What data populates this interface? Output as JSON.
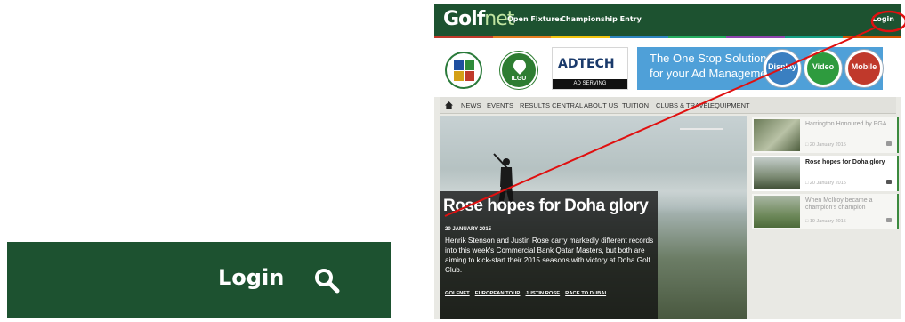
{
  "callout": {
    "login_label": "Login",
    "search_icon": "search-icon",
    "bg_color": "#1d5230"
  },
  "site": {
    "logo_main": "Golf",
    "logo_suffix": "net",
    "topnav": [
      "Open Fixtures",
      "Championship Entry"
    ],
    "login_label": "Login",
    "stripe_colors": [
      "#c0392b",
      "#e67e22",
      "#f1c40f",
      "#2e86c1",
      "#27ae60",
      "#8e44ad",
      "#16a085",
      "#d35400"
    ]
  },
  "banner": {
    "crest2_text": "ILGU",
    "ad_brand": "ADTECH",
    "ad_brand_sub": "AD SERVING",
    "ad_line1": "The One Stop Solution",
    "ad_line2": "for your Ad Management!",
    "pills": [
      {
        "label": "Display",
        "color": "#3a7fc1"
      },
      {
        "label": "Video",
        "color": "#2e9b3e"
      },
      {
        "label": "Mobile",
        "color": "#c0392b"
      }
    ]
  },
  "mainnav": {
    "home_icon": "home-icon",
    "items": [
      "NEWS",
      "EVENTS",
      "RESULTS CENTRAL",
      "ABOUT US",
      "TUITION",
      "CLUBS & TRAVEL",
      "EQUIPMENT"
    ]
  },
  "hero": {
    "headline": "Rose hopes for Doha glory",
    "date": "20 JANUARY 2015",
    "body": "Henrik Stenson and Justin Rose carry markedly different records into this week's Commercial Bank Qatar Masters, but both are aiming to kick-start their 2015 seasons with victory at Doha Golf Club.",
    "tags": [
      "GOLFNET",
      "EUROPEAN TOUR",
      "JUSTIN ROSE",
      "RACE TO DUBAI"
    ]
  },
  "sidebar": {
    "items": [
      {
        "title": "Harrington Honoured by PGA",
        "date": "20 January 2015",
        "active": false
      },
      {
        "title": "Rose hopes for Doha glory",
        "date": "20 January 2015",
        "active": true
      },
      {
        "title": "When McIlroy became a champion's champion",
        "date": "19 January 2015",
        "active": false
      }
    ]
  },
  "annotation": {
    "color": "#e01010"
  }
}
